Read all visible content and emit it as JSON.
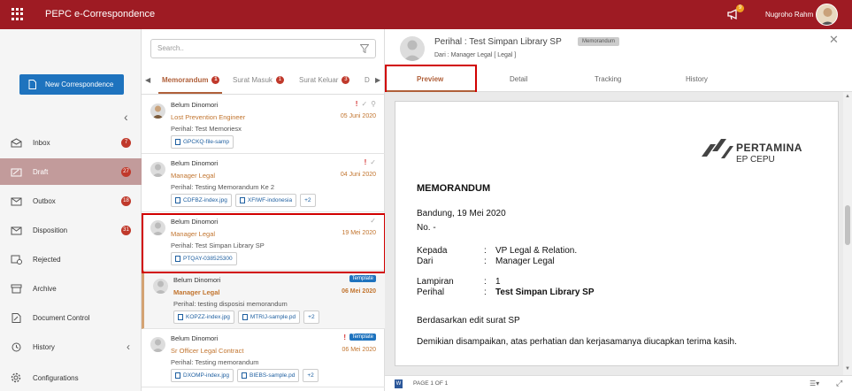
{
  "app": {
    "title": "PEPC e-Correspondence"
  },
  "topbar": {
    "notif_count": "9",
    "user_name": "Nugroho Rahm"
  },
  "sidebar": {
    "new_button": "New Correspondence",
    "items": [
      {
        "label": "Inbox",
        "badge": "7",
        "icon": "inbox-icon"
      },
      {
        "label": "Draft",
        "badge": "27",
        "icon": "draft-icon",
        "active": true
      },
      {
        "label": "Outbox",
        "badge": "18",
        "icon": "outbox-icon"
      },
      {
        "label": "Disposition",
        "badge": "31",
        "icon": "disposition-icon"
      },
      {
        "label": "Rejected",
        "badge": "",
        "icon": "rejected-icon"
      },
      {
        "label": "Archive",
        "badge": "",
        "icon": "archive-icon"
      },
      {
        "label": "Document Control",
        "badge": "",
        "icon": "document-control-icon"
      },
      {
        "label": "History",
        "badge": "",
        "icon": "history-icon"
      },
      {
        "label": "Configurations",
        "badge": "",
        "icon": "gear-icon"
      }
    ]
  },
  "list": {
    "search_placeholder": "Search..",
    "tabs": [
      {
        "label": "Memorandum",
        "badge": "1"
      },
      {
        "label": "Surat Masuk",
        "badge": "1"
      },
      {
        "label": "Surat Keluar",
        "badge": "3"
      },
      {
        "label": "D",
        "badge": ""
      }
    ],
    "messages": [
      {
        "sender": "Belum Dinomori",
        "role": "Lost Prevention Engineer",
        "subject": "Perihal: Test Memoriesx",
        "date": "05 Juni 2020",
        "attachments": [
          "GPCKQ-file-samp"
        ],
        "extra": ""
      },
      {
        "sender": "Belum Dinomori",
        "role": "Manager Legal",
        "subject": "Perihal: Testing Memorandum Ke 2",
        "date": "04 Juni 2020",
        "attachments": [
          "CDFBZ-index.jpg",
          "XFIWF-indonesia"
        ],
        "extra": "+2"
      },
      {
        "sender": "Belum Dinomori",
        "role": "Manager Legal",
        "subject": "Perihal: Test Simpan Library SP",
        "date": "19 Mei 2020",
        "attachments": [
          "PTQAY-038525300"
        ],
        "extra": ""
      },
      {
        "sender": "Belum Dinomori",
        "role": "Manager Legal",
        "subject": "Perihal: testing disposisi memorandum",
        "date": "06 Mei 2020",
        "attachments": [
          "KOPZZ-index.jpg",
          "MTRIJ-sample.pd"
        ],
        "extra": "+2",
        "template": "Template"
      },
      {
        "sender": "Belum Dinomori",
        "role": "Sr Officer Legal Contract",
        "subject": "Perihal: Testing memorandum",
        "date": "06 Mei 2020",
        "attachments": [
          "DXOMP-index.jpg",
          "BIEBS-sample.pd"
        ],
        "extra": "+2",
        "template": "Template"
      }
    ]
  },
  "preview": {
    "title": "Perihal : Test Simpan Library SP",
    "tag": "Memorandum",
    "from": "Dari : Manager Legal [ Legal ]",
    "tabs": [
      "Preview",
      "Detail",
      "Tracking",
      "History"
    ],
    "document": {
      "logo_line1": "PERTAMINA",
      "logo_line2": "EP CEPU",
      "heading": "MEMORANDUM",
      "place_date": "Bandung, 19 Mei 2020",
      "number": "No. -",
      "kepada_label": "Kepada",
      "kepada_value": "VP Legal & Relation.",
      "dari_label": "Dari",
      "dari_value": "Manager Legal",
      "lampiran_label": "Lampiran",
      "lampiran_value": "1",
      "perihal_label": "Perihal",
      "perihal_value": "Test Simpan Library SP",
      "colon": ":",
      "body1": "Berdasarkan edit surat  SP",
      "body2": "Demikian disampaikan, atas perhatian dan kerjasamanya diucapkan terima kasih."
    },
    "status": {
      "page_info": "PAGE 1 OF 1"
    }
  },
  "colors": {
    "brand": "#9e1b23",
    "accent": "#1e73be",
    "highlight": "#d10000"
  }
}
